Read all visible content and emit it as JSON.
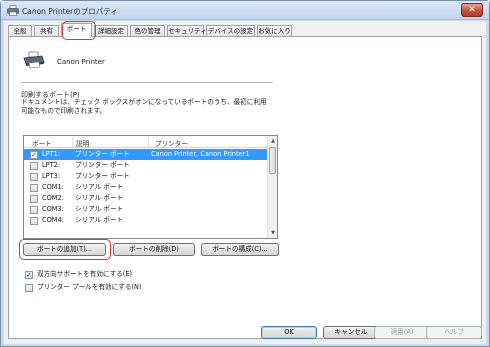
{
  "window": {
    "title": "Canon Printerのプロパティ",
    "close_glyph": "✕"
  },
  "tabs": [
    {
      "label": "全般"
    },
    {
      "label": "共有"
    },
    {
      "label": "ポート"
    },
    {
      "label": "詳細設定"
    },
    {
      "label": "色の管理"
    },
    {
      "label": "セキュリティ"
    },
    {
      "label": "デバイスの設定"
    },
    {
      "label": "お気に入り"
    }
  ],
  "active_tab": "ポート",
  "printer": {
    "name": "Canon Printer"
  },
  "ports_section": {
    "heading": "印刷するポート(P)",
    "description": "ドキュメントは、チェック ボックスがオンになっているポートのうち、最初に利用可能なもので印刷されます。"
  },
  "ports_table": {
    "columns": [
      "ポート",
      "説明",
      "プリンター"
    ],
    "rows": [
      {
        "checked": true,
        "port": "LPT1:",
        "desc": "プリンター ポート",
        "printer": "Canon Printer, Canon Printer1",
        "selected": true
      },
      {
        "checked": false,
        "port": "LPT2:",
        "desc": "プリンター ポート",
        "printer": "",
        "selected": false
      },
      {
        "checked": false,
        "port": "LPT3:",
        "desc": "プリンター ポート",
        "printer": "",
        "selected": false
      },
      {
        "checked": false,
        "port": "COM1:",
        "desc": "シリアル ポート",
        "printer": "",
        "selected": false
      },
      {
        "checked": false,
        "port": "COM2:",
        "desc": "シリアル ポート",
        "printer": "",
        "selected": false
      },
      {
        "checked": false,
        "port": "COM3:",
        "desc": "シリアル ポート",
        "printer": "",
        "selected": false
      },
      {
        "checked": false,
        "port": "COM4:",
        "desc": "シリアル ポート",
        "printer": "",
        "selected": false
      }
    ]
  },
  "port_buttons": {
    "add": "ポートの追加(T)...",
    "delete": "ポートの削除(D)",
    "configure": "ポートの構成(C)..."
  },
  "options": {
    "bidirectional": {
      "label": "双方向サポートを有効にする(E)",
      "checked": true
    },
    "pooling": {
      "label": "プリンター プールを有効にする(N)",
      "checked": false
    }
  },
  "dialog_buttons": {
    "ok": "OK",
    "cancel": "キャンセル",
    "apply": "適用(A)",
    "help": "ヘルプ"
  },
  "colors": {
    "selection": "#3399ff",
    "highlight_annotation": "#d93a2f"
  }
}
